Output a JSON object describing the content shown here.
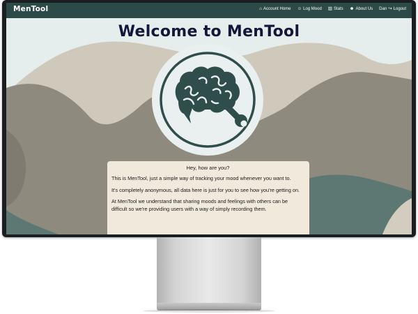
{
  "navbar": {
    "brand": "MenTool",
    "links": [
      {
        "icon": "home-icon",
        "glyph": "⌂",
        "label": "Account Home"
      },
      {
        "icon": "smile-icon",
        "glyph": "☺",
        "label": "Log Mood"
      },
      {
        "icon": "chart-icon",
        "glyph": "▥",
        "label": "Stats"
      },
      {
        "icon": "users-icon",
        "glyph": "☻",
        "label": "About Us"
      },
      {
        "icon": "logout-icon",
        "glyph": "↪",
        "label": "Dan"
      },
      {
        "label": "Logout"
      }
    ]
  },
  "main": {
    "title": "Welcome to MenTool",
    "card": {
      "heading": "Hey, how are you?",
      "paragraphs": [
        "This is MenTool, just a simple way of tracking your mood whenever you want to.",
        "It's completely anonymous, all data here is just for you to see how you're getting on.",
        "At MenTool we understand that sharing moods and feelings with others can be difficult so we're providing users with a way of simply recording them."
      ]
    }
  },
  "colors": {
    "navbar": "#2c4a47",
    "title": "#14173a",
    "card": "#f1e9dc",
    "hill_light": "#cfc9bb",
    "hill_mid": "#8e8a7e",
    "hill_teal": "#5d7873",
    "logo": "#2f4e4b"
  }
}
